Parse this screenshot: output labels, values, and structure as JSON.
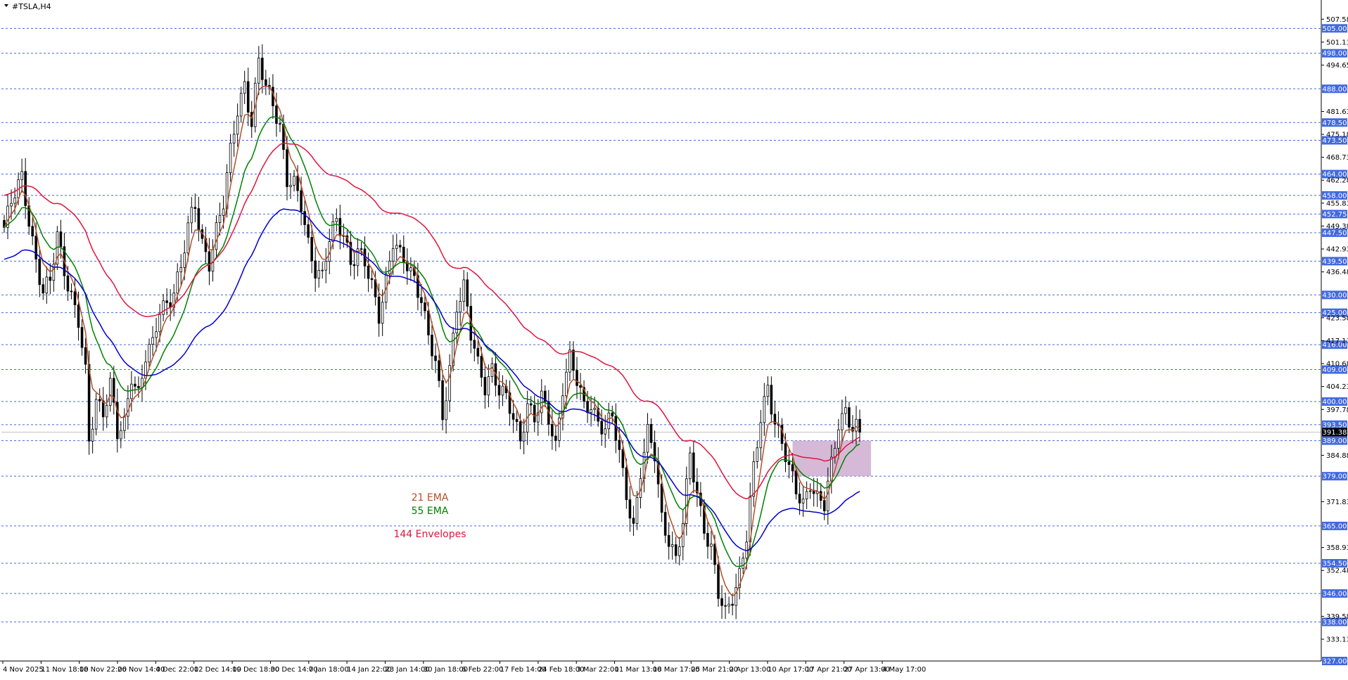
{
  "chart_data": {
    "type": "candlestick",
    "symbol": "#TSLA,H4",
    "ylim": [
      327,
      511
    ],
    "y_ticks": [
      "507.58",
      "501.13",
      "494.65",
      "481.63",
      "475.18",
      "468.73",
      "462.28",
      "455.83",
      "449.38",
      "442.93",
      "436.48",
      "423.58",
      "417.13",
      "410.68",
      "404.23",
      "397.78",
      "384.88",
      "371.83",
      "358.93",
      "352.48",
      "339.58",
      "333.13"
    ],
    "horizontal_levels": [
      "505.00",
      "498.00",
      "488.00",
      "478.50",
      "473.50",
      "464.00",
      "458.00",
      "452.75",
      "447.50",
      "439.50",
      "430.00",
      "425.00",
      "416.00",
      "409.00",
      "400.00",
      "393.50",
      "389.00",
      "379.00",
      "365.00",
      "354.50",
      "346.00",
      "338.00",
      "327.00"
    ],
    "current_price": "391.38",
    "x_ticks": [
      "4 Nov 2025",
      "11 Nov 18:00",
      "18 Nov 22:00",
      "26 Nov 14:00",
      "4 Dec 22:00",
      "12 Dec 14:00",
      "19 Dec 18:00",
      "30 Dec 14:00",
      "7 Jan 18:00",
      "14 Jan 22:00",
      "23 Jan 14:00",
      "30 Jan 18:00",
      "6 Feb 22:00",
      "17 Feb 14:00",
      "24 Feb 18:00",
      "3 Mar 22:00",
      "11 Mar 13:00",
      "18 Mar 17:00",
      "25 Mar 21:00",
      "2 Apr 13:00",
      "10 Apr 17:00",
      "17 Apr 21:00",
      "27 Apr 13:00",
      "4 May 17:00"
    ],
    "price_path": [
      [
        0,
        449
      ],
      [
        3,
        458
      ],
      [
        5,
        463
      ],
      [
        7,
        452
      ],
      [
        9,
        440
      ],
      [
        11,
        430
      ],
      [
        13,
        433
      ],
      [
        15,
        447
      ],
      [
        17,
        438
      ],
      [
        19,
        430
      ],
      [
        21,
        422
      ],
      [
        23,
        407
      ],
      [
        24,
        388
      ],
      [
        26,
        401
      ],
      [
        28,
        398
      ],
      [
        30,
        405
      ],
      [
        32,
        390
      ],
      [
        34,
        393
      ],
      [
        36,
        408
      ],
      [
        38,
        403
      ],
      [
        40,
        413
      ],
      [
        42,
        415
      ],
      [
        44,
        425
      ],
      [
        46,
        428
      ],
      [
        48,
        432
      ],
      [
        50,
        438
      ],
      [
        52,
        448
      ],
      [
        54,
        455
      ],
      [
        56,
        445
      ],
      [
        58,
        440
      ],
      [
        60,
        448
      ],
      [
        62,
        455
      ],
      [
        64,
        470
      ],
      [
        66,
        483
      ],
      [
        68,
        490
      ],
      [
        70,
        478
      ],
      [
        72,
        495
      ],
      [
        74,
        488
      ],
      [
        76,
        485
      ],
      [
        78,
        478
      ],
      [
        80,
        462
      ],
      [
        82,
        460
      ],
      [
        84,
        455
      ],
      [
        86,
        445
      ],
      [
        88,
        438
      ],
      [
        90,
        435
      ],
      [
        92,
        445
      ],
      [
        94,
        450
      ],
      [
        96,
        448
      ],
      [
        98,
        440
      ],
      [
        100,
        442
      ],
      [
        102,
        438
      ],
      [
        104,
        432
      ],
      [
        106,
        425
      ],
      [
        108,
        435
      ],
      [
        110,
        445
      ],
      [
        112,
        440
      ],
      [
        114,
        438
      ],
      [
        116,
        435
      ],
      [
        118,
        430
      ],
      [
        120,
        418
      ],
      [
        122,
        410
      ],
      [
        124,
        395
      ],
      [
        126,
        410
      ],
      [
        128,
        428
      ],
      [
        130,
        432
      ],
      [
        132,
        418
      ],
      [
        134,
        410
      ],
      [
        136,
        405
      ],
      [
        138,
        410
      ],
      [
        140,
        403
      ],
      [
        142,
        400
      ],
      [
        144,
        395
      ],
      [
        146,
        390
      ],
      [
        148,
        400
      ],
      [
        150,
        395
      ],
      [
        152,
        400
      ],
      [
        154,
        395
      ],
      [
        156,
        388
      ],
      [
        158,
        405
      ],
      [
        160,
        412
      ],
      [
        162,
        405
      ],
      [
        164,
        398
      ],
      [
        166,
        400
      ],
      [
        168,
        395
      ],
      [
        170,
        392
      ],
      [
        172,
        395
      ],
      [
        174,
        385
      ],
      [
        176,
        375
      ],
      [
        178,
        365
      ],
      [
        180,
        380
      ],
      [
        182,
        390
      ],
      [
        184,
        385
      ],
      [
        186,
        368
      ],
      [
        188,
        362
      ],
      [
        190,
        355
      ],
      [
        192,
        365
      ],
      [
        194,
        385
      ],
      [
        196,
        375
      ],
      [
        198,
        365
      ],
      [
        200,
        358
      ],
      [
        202,
        345
      ],
      [
        204,
        340
      ],
      [
        206,
        346
      ],
      [
        208,
        352
      ],
      [
        210,
        362
      ],
      [
        212,
        380
      ],
      [
        214,
        395
      ],
      [
        216,
        405
      ],
      [
        218,
        395
      ],
      [
        220,
        388
      ],
      [
        222,
        380
      ],
      [
        224,
        375
      ],
      [
        226,
        372
      ],
      [
        228,
        378
      ],
      [
        230,
        372
      ],
      [
        232,
        370
      ],
      [
        234,
        382
      ],
      [
        236,
        395
      ],
      [
        238,
        398
      ],
      [
        240,
        392
      ],
      [
        242,
        391.38
      ]
    ],
    "series": [
      {
        "name": "21 EMA",
        "color": "#b0522a",
        "smoothing": 21
      },
      {
        "name": "55 EMA",
        "color": "#008000",
        "smoothing": 55
      },
      {
        "name": "144 Envelopes",
        "color": "#e0143c",
        "smoothing": 144,
        "offset": 1.02
      },
      {
        "name": "",
        "color": "#0000cd",
        "smoothing": 144,
        "offset": 0.98
      }
    ],
    "zone": {
      "from_price": 379,
      "to_price": 389,
      "color": "#c8a2c8"
    },
    "grid": false
  },
  "colors": {
    "level_line": "#4169e1",
    "level_box": "#4169e1",
    "candle": "#000000",
    "current_line": "#c0c0c0",
    "current_box": "#000000"
  }
}
